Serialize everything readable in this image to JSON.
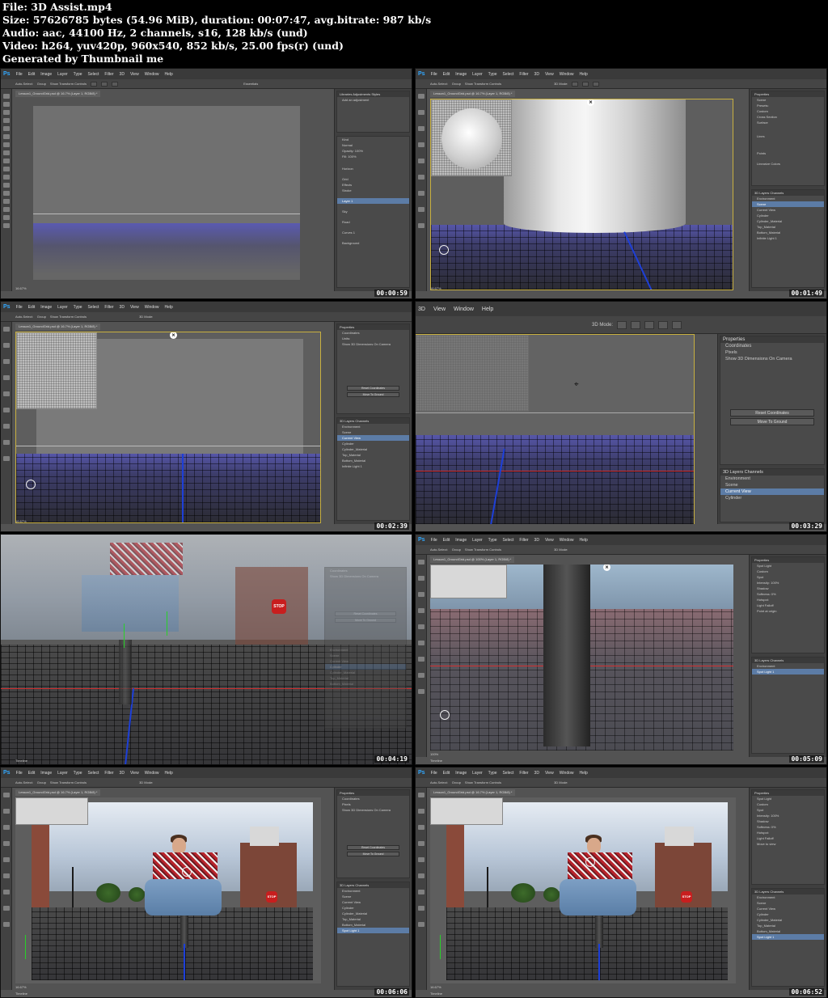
{
  "info": {
    "file": "File: 3D Assist.mp4",
    "size": "Size: 57626785 bytes (54.96 MiB), duration: 00:07:47, avg.bitrate: 987 kb/s",
    "audio": "Audio: aac, 44100 Hz, 2 channels, s16, 128 kb/s (und)",
    "video": "Video: h264, yuv420p, 960x540, 852 kb/s, 25.00 fps(r) (und)",
    "generator": "Generated by Thumbnail me"
  },
  "ps": {
    "logo": "Ps",
    "menu": [
      "File",
      "Edit",
      "Image",
      "Layer",
      "Type",
      "Select",
      "Filter",
      "3D",
      "View",
      "Window",
      "Help"
    ],
    "options": {
      "auto_select": "Auto-Select:",
      "group": "Group",
      "transform": "Show Transform Controls",
      "mode": "3D Mode:",
      "essentials": "Essentials"
    },
    "doc_tab_167": "Lesson1_GroundGrid.psd @ 16.7% (Layer 1, RGB/8) *",
    "doc_tab_100": "Lesson1_GroundGrid.psd @ 100% (Layer 1, RGB/8) *",
    "zoom_167": "16.67%",
    "zoom_100": "100%",
    "doc_size": "Doc: 46.3M/96.9M",
    "timeline": "Timeline"
  },
  "frames": [
    {
      "timestamp": "00:00:59"
    },
    {
      "timestamp": "00:01:49"
    },
    {
      "timestamp": "00:02:39"
    },
    {
      "timestamp": "00:03:29"
    },
    {
      "timestamp": "00:04:19"
    },
    {
      "timestamp": "00:05:09"
    },
    {
      "timestamp": "00:06:06"
    },
    {
      "timestamp": "00:06:52"
    }
  ],
  "panels": {
    "adjustments": {
      "tabs": "Libraries   Adjustments   Styles",
      "add": "Add an adjustment"
    },
    "layers": {
      "kind": "Kind",
      "normal": "Normal",
      "opacity": "Opacity: 100%",
      "lock": "Lock:",
      "fill": "Fill: 100%",
      "items": [
        "Horizon",
        "Grid",
        "Effects",
        "Stroke",
        "Layer 1",
        "Sky",
        "Road",
        "Curves 1",
        "Background"
      ]
    },
    "scene": {
      "title": "Properties",
      "scene": "Scene",
      "presets": "Presets:",
      "preset_val": "Custom",
      "rows": [
        "Cross Section",
        "Surface",
        "Lines",
        "Points",
        "Linearize Colors"
      ]
    },
    "coordinates": {
      "title": "Coordinates",
      "units": "Units:",
      "units_val": "Pixels",
      "show": "Show 3D Dimensions On Camera",
      "reset": "Reset Coordinates",
      "move": "Move To Ground"
    },
    "spotlight": {
      "title": "Spot Light",
      "preset": "Preset:",
      "preset_val": "Custom",
      "type": "Type:",
      "type_val": "Spot",
      "color": "Color:",
      "intensity": "Intensity: 100%",
      "shadow": "Shadow",
      "softness": "Softness: 0%",
      "hotspot": "Hotspot:",
      "cone": "Cone:",
      "falloff": "Light Falloff",
      "point": "Point at origin",
      "move": "Move to view"
    },
    "tree_tabs": "3D   Layers   Channels",
    "tree": [
      "Environment",
      "Scene",
      "Current View",
      "Cylinder",
      "Cylinder_Material",
      "Top_Material",
      "Bottom_Material",
      "Infinite Light 1"
    ],
    "tree_spot": [
      "Environment",
      "Spot Light 1"
    ],
    "tree_full": [
      "Environment",
      "Scene",
      "Current View",
      "Cylinder",
      "Cylinder_Material",
      "Top_Material",
      "Bottom_Material",
      "Spot Light 1"
    ]
  },
  "scene_text": {
    "stop": "STOP"
  }
}
